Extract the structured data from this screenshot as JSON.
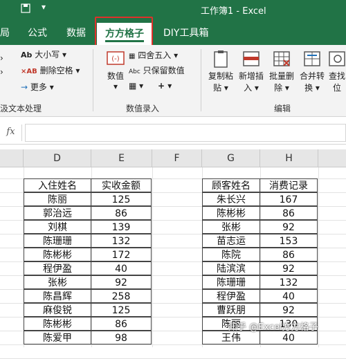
{
  "titlebar": {
    "title": "工作簿1  -  Excel",
    "bg": "#217346"
  },
  "tabs": [
    {
      "label": "局",
      "active": false
    },
    {
      "label": "公式",
      "active": false
    },
    {
      "label": "数据",
      "active": false
    },
    {
      "label": "方方格子",
      "active": true
    },
    {
      "label": "DIY工具箱",
      "active": false
    }
  ],
  "ribbon": {
    "text_group": {
      "items": [
        "大小写",
        "删除空格",
        "更多"
      ],
      "name": "汲文本处理"
    },
    "numeric_group": {
      "value_label": "数值",
      "round_label": "四舍五入",
      "keep_value_label": "只保留数值",
      "name": "数值录入"
    },
    "edit_group": {
      "buttons": [
        {
          "line1": "复制粘",
          "line2": "贴"
        },
        {
          "line1": "新增插",
          "line2": "入"
        },
        {
          "line1": "批量删",
          "line2": "除"
        },
        {
          "line1": "合并转",
          "line2": "换"
        },
        {
          "line1": "查找",
          "line2": "位"
        }
      ],
      "name": "编辑"
    }
  },
  "formula_bar": {
    "fx": "fx",
    "value": ""
  },
  "columns": [
    "D",
    "E",
    "F",
    "G",
    "H"
  ],
  "table1": {
    "headers": [
      "入住姓名",
      "实收金额"
    ],
    "rows": [
      [
        "陈丽",
        "125"
      ],
      [
        "郭治远",
        "86"
      ],
      [
        "刘棋",
        "139"
      ],
      [
        "陈珊珊",
        "132"
      ],
      [
        "陈彬彬",
        "172"
      ],
      [
        "程伊盈",
        "40"
      ],
      [
        "张彬",
        "92"
      ],
      [
        "陈昌辉",
        "258"
      ],
      [
        "麻俊锐",
        "125"
      ],
      [
        "陈彬彬",
        "86"
      ],
      [
        "陈爱甲",
        "98"
      ]
    ]
  },
  "table2": {
    "headers": [
      "顾客姓名",
      "消费记录"
    ],
    "rows": [
      [
        "朱长兴",
        "167"
      ],
      [
        "陈彬彬",
        "86"
      ],
      [
        "张彬",
        "92"
      ],
      [
        "苗志运",
        "153"
      ],
      [
        "陈院",
        "86"
      ],
      [
        "陆滨滨",
        "92"
      ],
      [
        "陈珊珊",
        "132"
      ],
      [
        "程伊盈",
        "40"
      ],
      [
        "曹跃朋",
        "92"
      ],
      [
        "陈丽",
        "130"
      ],
      [
        "王伟",
        "40"
      ]
    ]
  },
  "watermark": "知乎 @Excel方方格子"
}
